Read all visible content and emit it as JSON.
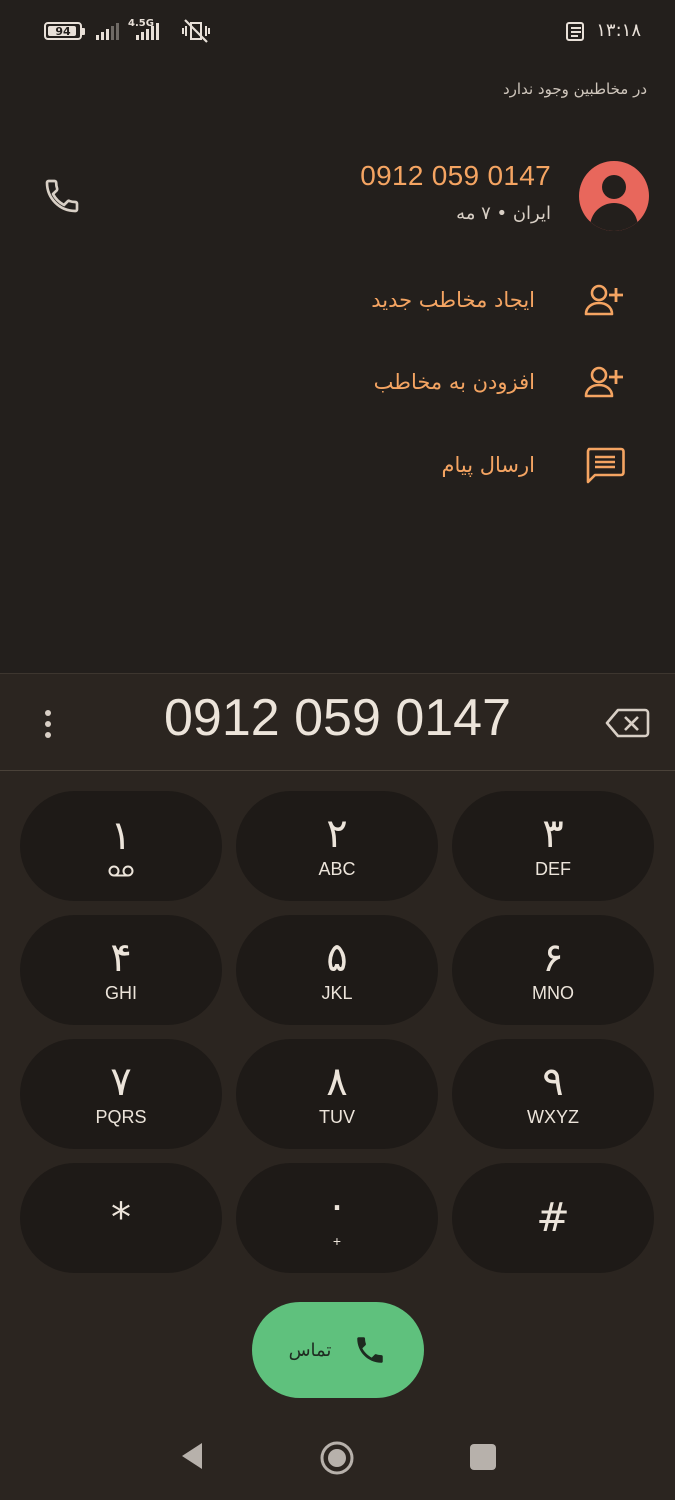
{
  "status_bar": {
    "battery": "94",
    "network_type": "4.5G",
    "time": "۱۳:۱۸"
  },
  "contact_card": {
    "note": "در مخاطبین وجود ندارد",
    "phone_number": "0912 059 0147",
    "subtitle": "ایران • ۷ مه",
    "avatar_color": "#e8675c",
    "accent_color": "#f4a462"
  },
  "actions": [
    {
      "label": "ایجاد مخاطب جدید",
      "icon": "person-add-icon"
    },
    {
      "label": "افزودن به مخاطب",
      "icon": "person-add-icon"
    },
    {
      "label": "ارسال پیام",
      "icon": "message-icon"
    }
  ],
  "dialpad": {
    "digits": "0912 059 0147",
    "keys": [
      {
        "digit": "۱",
        "letters": ""
      },
      {
        "digit": "۲",
        "letters": "ABC"
      },
      {
        "digit": "۳",
        "letters": "DEF"
      },
      {
        "digit": "۴",
        "letters": "GHI"
      },
      {
        "digit": "۵",
        "letters": "JKL"
      },
      {
        "digit": "۶",
        "letters": "MNO"
      },
      {
        "digit": "۷",
        "letters": "PQRS"
      },
      {
        "digit": "۸",
        "letters": "TUV"
      },
      {
        "digit": "۹",
        "letters": "WXYZ"
      },
      {
        "digit": "*",
        "letters": ""
      },
      {
        "digit": "۰",
        "letters": "+"
      },
      {
        "digit": "#",
        "letters": ""
      }
    ]
  },
  "call_button": {
    "label": "تماس",
    "color": "#5fc17d"
  }
}
